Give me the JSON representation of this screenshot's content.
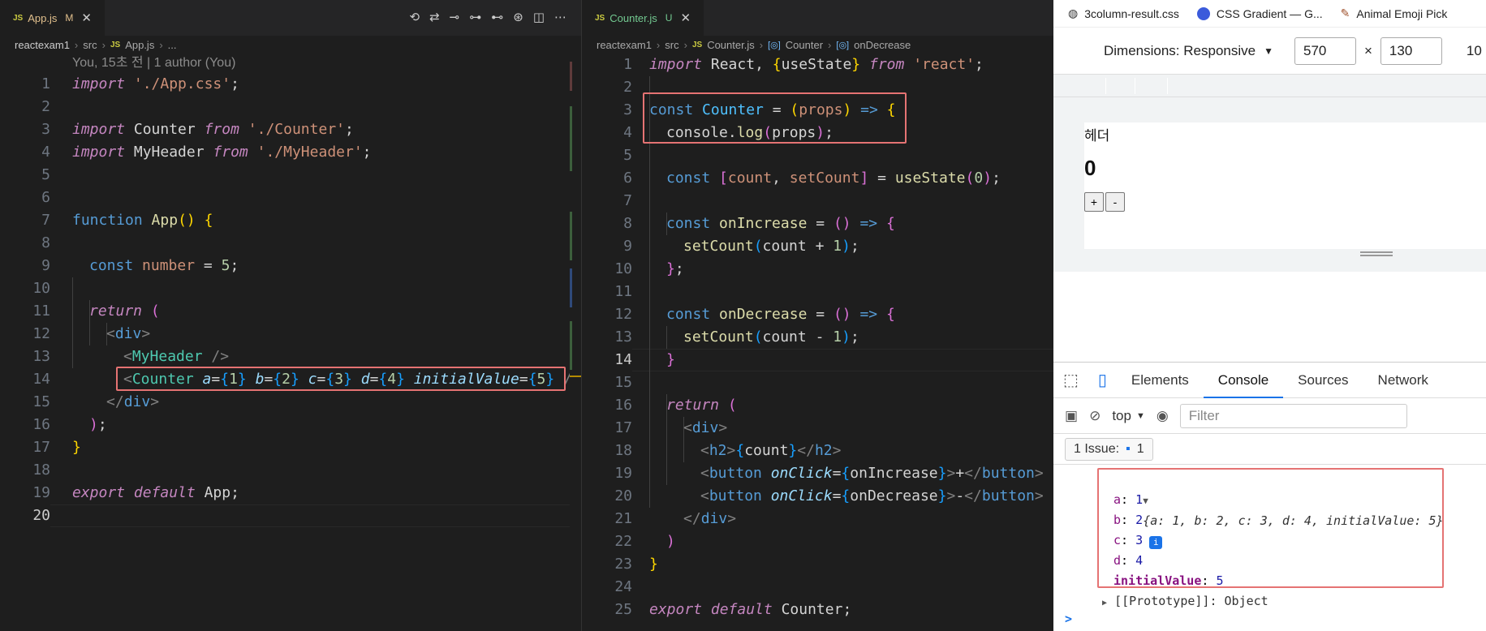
{
  "left_editor": {
    "tab": {
      "label": "App.js",
      "flag": "M",
      "badge": "JS"
    },
    "breadcrumb": {
      "root": "reactexam1",
      "folder": "src",
      "file": "App.js",
      "tail": "..."
    },
    "codelens": "You, 15초 전 | 1 author (You)",
    "current_line": 20,
    "line_numbers": [
      "1",
      "2",
      "3",
      "4",
      "5",
      "6",
      "7",
      "8",
      "9",
      "10",
      "11",
      "12",
      "13",
      "14",
      "15",
      "16",
      "17",
      "18",
      "19",
      "20"
    ]
  },
  "mid_editor": {
    "tab": {
      "label": "Counter.js",
      "flag": "U",
      "badge": "JS"
    },
    "breadcrumb": {
      "root": "reactexam1",
      "folder": "src",
      "file": "Counter.js",
      "symbol1": "Counter",
      "symbol2": "onDecrease"
    },
    "current_line": 14,
    "line_numbers": [
      "1",
      "2",
      "3",
      "4",
      "5",
      "6",
      "7",
      "8",
      "9",
      "10",
      "11",
      "12",
      "13",
      "14",
      "15",
      "16",
      "17",
      "18",
      "19",
      "20",
      "21",
      "22",
      "23",
      "24",
      "25"
    ]
  },
  "browser": {
    "bookmarks": [
      "3column-result.css",
      "CSS Gradient — G...",
      "Animal Emoji Pick"
    ],
    "dimensions_label": "Dimensions: Responsive",
    "width_value": "570",
    "times": "×",
    "height_value": "130",
    "trailing": "10",
    "page": {
      "header": "헤더",
      "count": "0",
      "plus": "+",
      "minus": "-"
    },
    "devtools_tabs": [
      "Elements",
      "Console",
      "Sources",
      "Network"
    ],
    "context": "top",
    "filter_placeholder": "Filter",
    "issues_label": "1 Issue:",
    "issues_count": "1",
    "console": {
      "summary": "{a: 1, b: 2, c: 3, d: 4, initialValue: 5}",
      "props": [
        {
          "key": "a",
          "value": "1"
        },
        {
          "key": "b",
          "value": "2"
        },
        {
          "key": "c",
          "value": "3"
        },
        {
          "key": "d",
          "value": "4"
        },
        {
          "key": "initialValue",
          "value": "5"
        }
      ],
      "prototype": "[[Prototype]]: Object",
      "prompt": ">"
    }
  }
}
